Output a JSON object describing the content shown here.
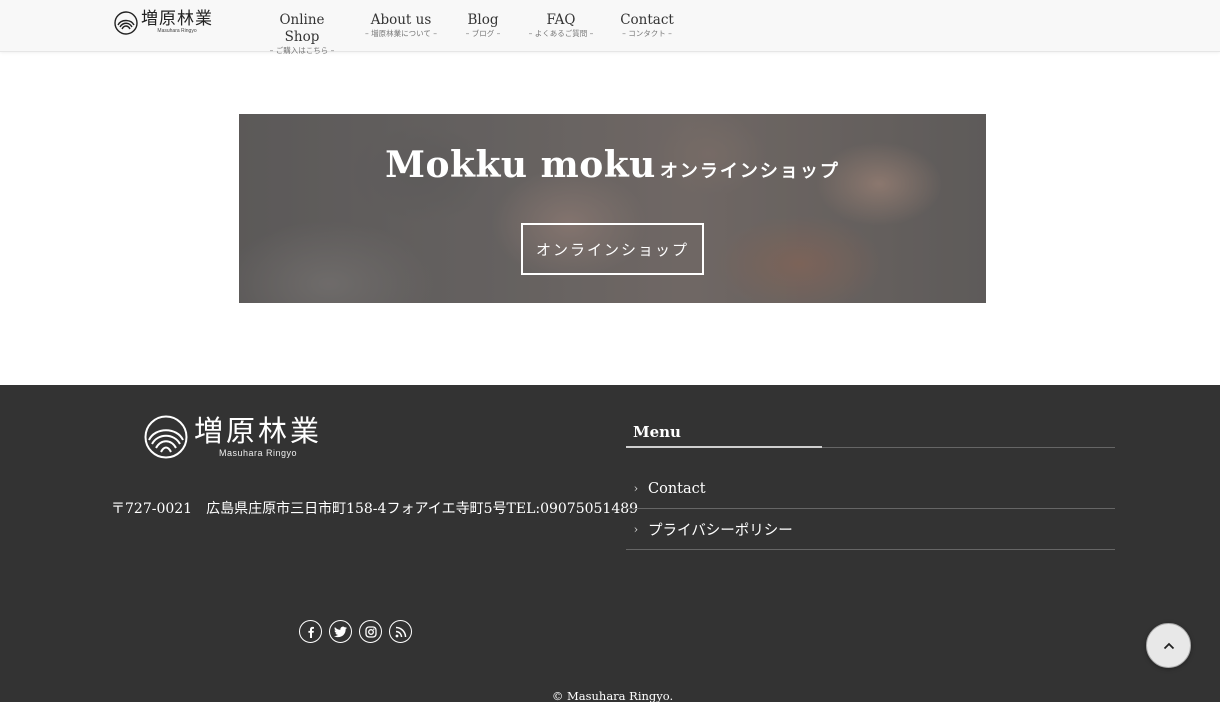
{
  "header": {
    "logo": {
      "jp": "増原林業",
      "en": "Masuhara Ringyo"
    },
    "nav": [
      {
        "en": "Online Shop",
        "jp": "– ご購入はこちら –"
      },
      {
        "en": "About us",
        "jp": "– 増原林業について –"
      },
      {
        "en": "Blog",
        "jp": "– ブログ –"
      },
      {
        "en": "FAQ",
        "jp": "– よくあるご質問 –"
      },
      {
        "en": "Contact",
        "jp": "– コンタクト –"
      }
    ]
  },
  "banner": {
    "title_big": "Mokku moku",
    "title_small": "オンラインショップ",
    "button_label": "オンラインショップ"
  },
  "footer": {
    "logo": {
      "jp": "増原林業",
      "en": "Masuhara Ringyo"
    },
    "address": "〒727-0021　広島県庄原市三日市町158-4フォアイエ寺町5号TEL:09075051489",
    "menu_heading": "Menu",
    "menu_items": [
      "Contact",
      "プライバシーポリシー"
    ],
    "social_icons": [
      "facebook-icon",
      "twitter-icon",
      "instagram-icon",
      "rss-icon"
    ],
    "copyright": "© Masuhara Ringyo."
  },
  "back_to_top_icon": "chevron-up-icon"
}
